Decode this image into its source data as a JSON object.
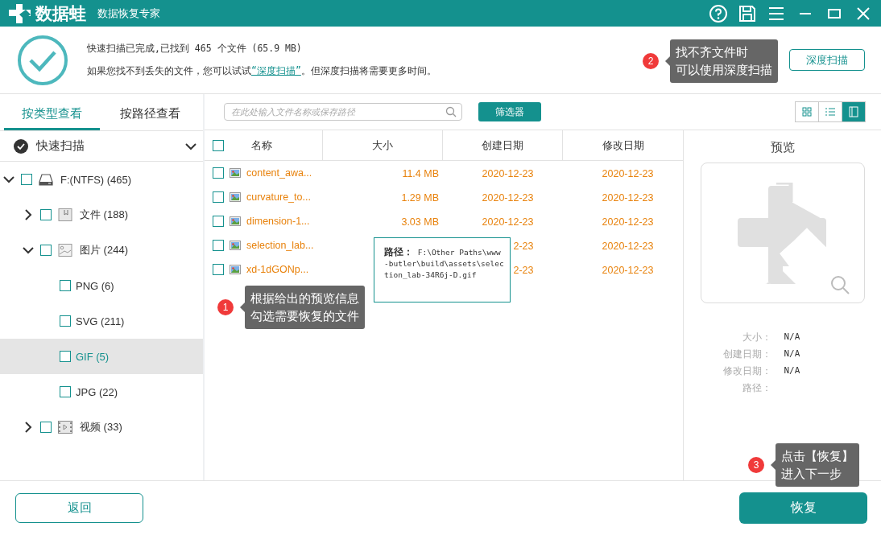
{
  "title_bar": {
    "app_name": "数据蛙",
    "subtitle": "数据恢复专家"
  },
  "summary": {
    "status": "快速扫描已完成,已找到 465 个文件 (65.9 MB)",
    "hint_before": "如果您找不到丢失的文件，您可以试试",
    "hint_link": "“深度扫描”",
    "hint_after": "。但深度扫描将需要更多时间。",
    "deep_scan_button": "深度扫描"
  },
  "tabs": [
    {
      "label": "按类型查看",
      "selected": true
    },
    {
      "label": "按路径查看",
      "selected": false
    }
  ],
  "scan_mode": {
    "label": "快速扫描"
  },
  "tree": [
    {
      "label": "F:(NTFS) (465)",
      "kind": "drive",
      "checked": false,
      "selected": false,
      "expanded": true,
      "children": [
        {
          "label": "文件 (188)",
          "kind": "document",
          "checked": false,
          "selected": false,
          "expanded": false
        },
        {
          "label": "图片 (244)",
          "kind": "image",
          "checked": false,
          "selected": false,
          "expanded": true,
          "children": [
            {
              "label": "PNG (6)",
              "checked": false,
              "selected": false
            },
            {
              "label": "SVG (211)",
              "checked": false,
              "selected": false
            },
            {
              "label": "GIF (5)",
              "checked": false,
              "selected": true
            },
            {
              "label": "JPG (22)",
              "checked": false,
              "selected": false
            }
          ]
        },
        {
          "label": "视频 (33)",
          "kind": "video",
          "checked": false,
          "selected": false,
          "expanded": false
        }
      ]
    }
  ],
  "search": {
    "placeholder": "在此处输入文件名称或保存路径"
  },
  "filter_button": "筛选器",
  "view_buttons": [
    {
      "kind": "grid",
      "selected": false
    },
    {
      "kind": "list",
      "selected": false
    },
    {
      "kind": "preview",
      "selected": true
    }
  ],
  "table": {
    "header_checked": false,
    "columns": [
      "名称",
      "大小",
      "创建日期",
      "修改日期"
    ],
    "rows": [
      {
        "name": "content_awa...",
        "size": "11.4 MB",
        "created": "2020-12-23",
        "modified": "2020-12-23",
        "checked": false
      },
      {
        "name": "curvature_to...",
        "size": "1.29 MB",
        "created": "2020-12-23",
        "modified": "2020-12-23",
        "checked": false
      },
      {
        "name": "dimension-1...",
        "size": "3.03 MB",
        "created": "2020-12-23",
        "modified": "2020-12-23",
        "checked": false
      },
      {
        "name": "selection_lab...",
        "created": "2-23",
        "modified": "2020-12-23",
        "checked": false
      },
      {
        "name": "xd-1dGONp...",
        "created": "2-23",
        "modified": "2020-12-23",
        "checked": false
      }
    ]
  },
  "path_tooltip": {
    "text": "**路径：** F:\\Other Paths\\www-butler\\build\\assets\\selection_lab-34R6j-D.gif"
  },
  "preview": {
    "title": "预览",
    "details": [
      {
        "label": "大小：",
        "value": "N/A"
      },
      {
        "label": "创建日期：",
        "value": "N/A"
      },
      {
        "label": "修改日期：",
        "value": "N/A"
      },
      {
        "label": "路径："
      }
    ]
  },
  "callouts": [
    {
      "number": "1",
      "lines": [
        "根据给出的预览信息",
        "勾选需要恢复的文件"
      ]
    },
    {
      "number": "2",
      "lines": [
        "找不齐文件时",
        "可以使用深度扫描"
      ]
    },
    {
      "number": "3",
      "lines": [
        "点击【恢复】",
        "进入下一步"
      ]
    }
  ],
  "footer": {
    "back_button": "返回",
    "recover_button": "恢复"
  }
}
